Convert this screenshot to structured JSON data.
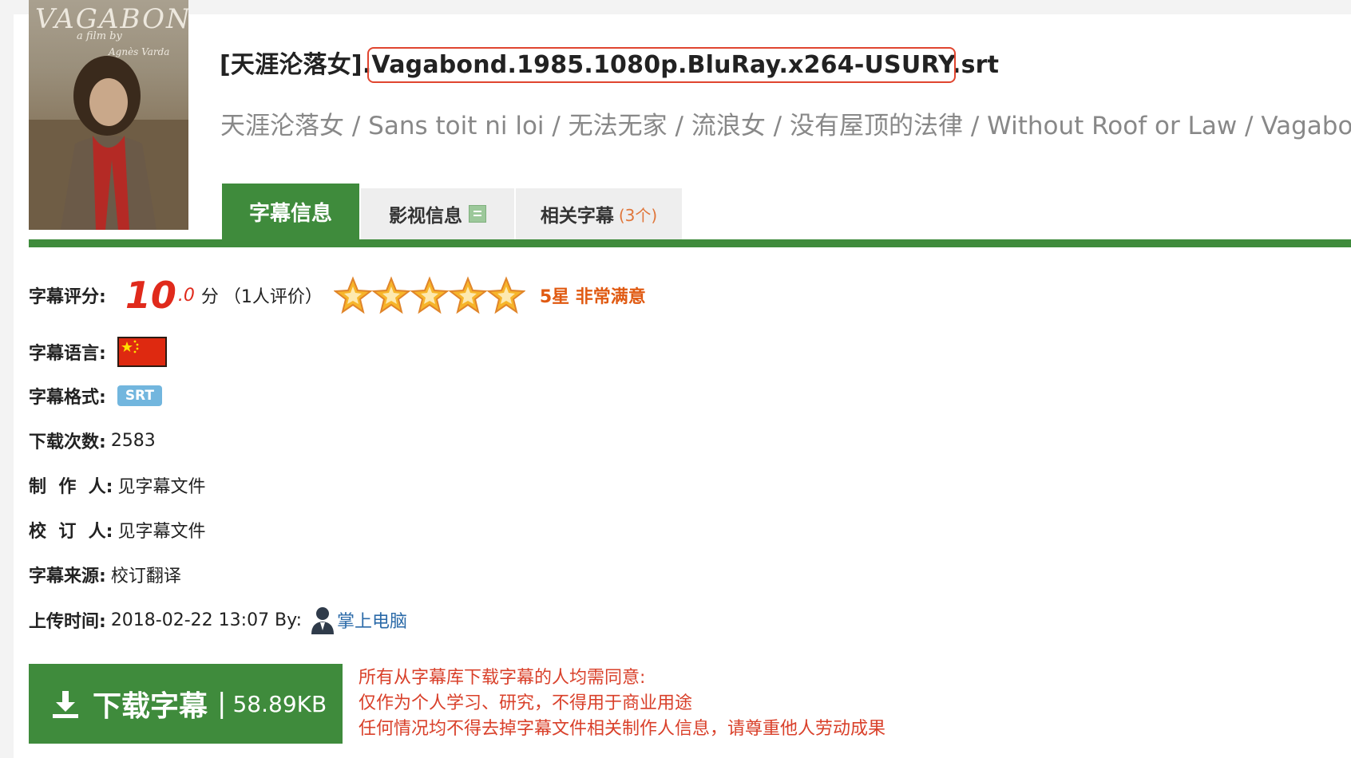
{
  "subtitle": {
    "title_prefix": "[天涯沦落女].",
    "title_highlight": "Vagabond.1985.1080p.BluRay.x264-USURY",
    "title_suffix": ".srt",
    "aka": "天涯沦落女 / Sans toit ni loi / 无法无家 / 流浪女 / 没有屋顶的法律 / Without Roof or Law / Vagabond (",
    "poster": {
      "title": "VAGABOND",
      "line1": "a film by",
      "line2": "Agnès Varda"
    }
  },
  "tabs": [
    {
      "label": "字幕信息",
      "count": ""
    },
    {
      "label": "影视信息",
      "count": ""
    },
    {
      "label": "相关字幕",
      "count": "(3个)"
    }
  ],
  "info": {
    "rating_label": "字幕评分:",
    "rating_int": "10",
    "rating_dec": ".0",
    "rating_unit": "分",
    "rating_votes": "（1人评价）",
    "rating_stars": 5,
    "rating_verdict": "5星 非常满意",
    "language_label": "字幕语言:",
    "format_label": "字幕格式:",
    "format_value": "SRT",
    "downloads_label": "下载次数:",
    "downloads_value": "2583",
    "maker_label": "制  作  人:",
    "maker_value": "见字幕文件",
    "proofreader_label": "校  订  人:",
    "proofreader_value": "见字幕文件",
    "source_label": "字幕来源:",
    "source_value": "校订翻译",
    "upload_label": "上传时间:",
    "upload_value": "2018-02-22 13:07 By:",
    "uploader": "掌上电脑"
  },
  "download": {
    "label": "下载字幕",
    "separator": "|",
    "size": "58.89KB"
  },
  "notice": [
    "所有从字幕库下载字幕的人均需同意:",
    "仅作为个人学习、研究，不得用于商业用途",
    "任何情况均不得去掉字幕文件相关制作人信息，请尊重他人劳动成果"
  ],
  "colors": {
    "accent_green": "#3f8b3c",
    "highlight_red": "#e0452f",
    "notice_red": "#d9402a",
    "score_red": "#e02a1c",
    "link_blue": "#2b6aa8"
  }
}
